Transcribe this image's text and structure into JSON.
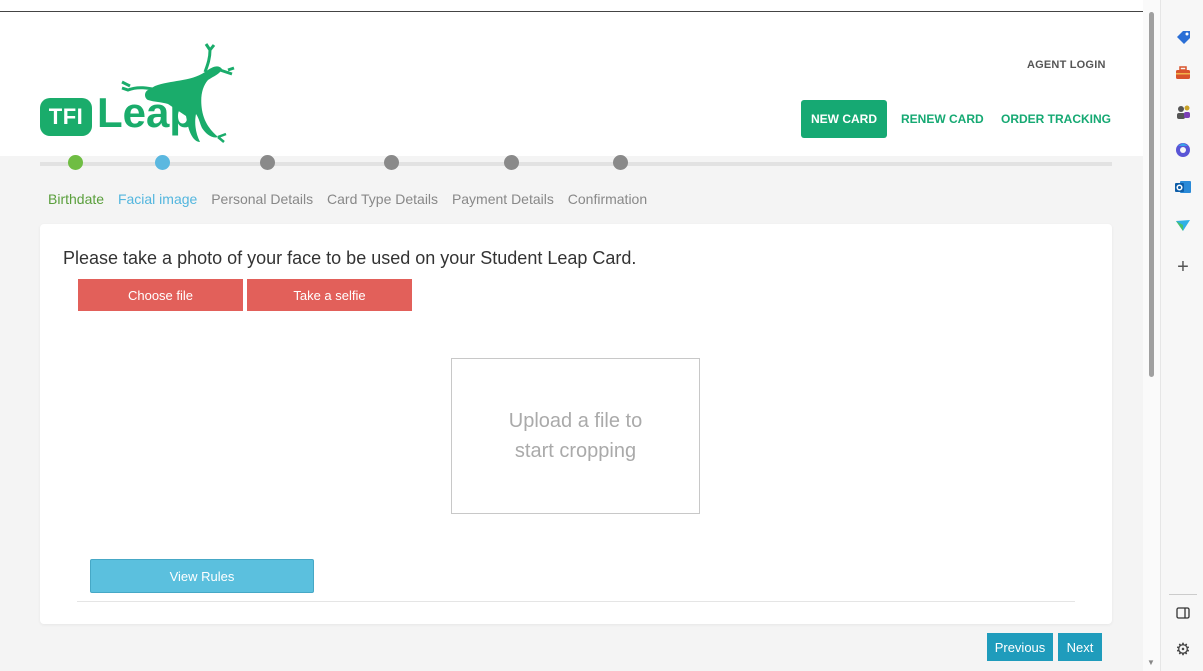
{
  "header": {
    "logo_badge": "TFI",
    "logo_word": "Leap",
    "agent_login": "AGENT LOGIN",
    "nav": {
      "new_card": "NEW CARD",
      "renew_card": "RENEW CARD",
      "order_tracking": "ORDER TRACKING"
    }
  },
  "steps": [
    {
      "label": "Birthdate",
      "state": "done",
      "color": "#5a9f3c"
    },
    {
      "label": "Facial image",
      "state": "active",
      "color": "#53b6de"
    },
    {
      "label": "Personal Details",
      "state": "pending"
    },
    {
      "label": "Card Type Details",
      "state": "pending"
    },
    {
      "label": "Payment Details",
      "state": "pending"
    },
    {
      "label": "Confirmation",
      "state": "pending"
    }
  ],
  "main": {
    "prompt": "Please take a photo of your face to be used on your Student Leap Card.",
    "choose_file": "Choose file",
    "take_selfie": "Take a selfie",
    "crop_placeholder_line1": "Upload a file to",
    "crop_placeholder_line2": "start cropping",
    "view_rules": "View Rules"
  },
  "footer_nav": {
    "previous": "Previous",
    "next": "Next"
  },
  "colors": {
    "brand_green": "#16a973",
    "selfie_red": "#e2605a",
    "info_blue": "#5bc0de",
    "nav_teal": "#1f9cbc"
  },
  "sidebar_icons": [
    "tag-icon",
    "toolbox-icon",
    "people-icon",
    "copilot-icon",
    "outlook-icon",
    "send-icon",
    "plus-icon",
    "panel-icon",
    "gear-icon"
  ]
}
